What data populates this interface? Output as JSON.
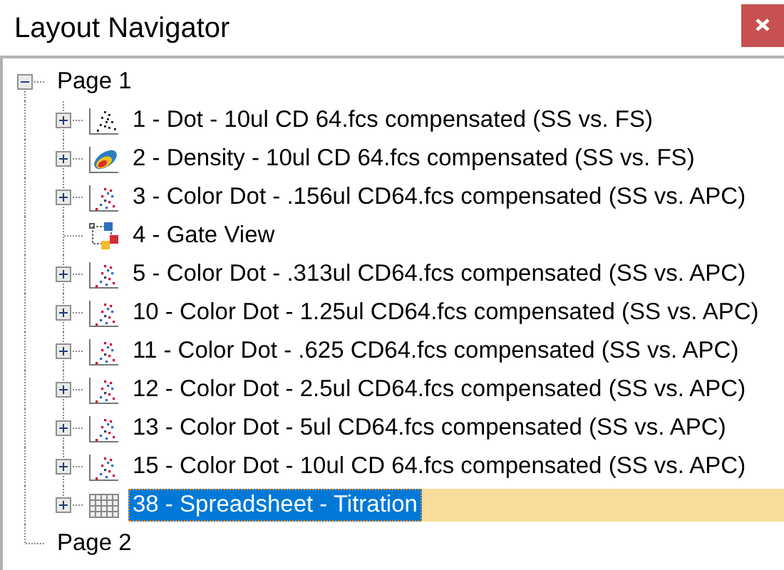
{
  "window": {
    "title": "Layout Navigator"
  },
  "tree": [
    {
      "label": "Page 1",
      "expandable": true,
      "expanded": true,
      "selected": false,
      "children": [
        {
          "label": "1 - Dot - 10ul CD 64.fcs compensated (SS vs. FS)",
          "kind": "dot",
          "expandable": true,
          "expanded": false,
          "selected": false
        },
        {
          "label": "2 - Density - 10ul CD 64.fcs compensated (SS vs. FS)",
          "kind": "density",
          "expandable": true,
          "expanded": false,
          "selected": false
        },
        {
          "label": "3 - Color Dot - .156ul CD64.fcs compensated (SS vs. APC)",
          "kind": "color-dot",
          "expandable": true,
          "expanded": false,
          "selected": false
        },
        {
          "label": "4 - Gate View",
          "kind": "gate",
          "expandable": false,
          "selected": false
        },
        {
          "label": "5 - Color Dot - .313ul CD64.fcs compensated (SS vs. APC)",
          "kind": "color-dot",
          "expandable": true,
          "expanded": false,
          "selected": false
        },
        {
          "label": "10 - Color Dot - 1.25ul CD64.fcs compensated (SS vs. APC)",
          "kind": "color-dot",
          "expandable": true,
          "expanded": false,
          "selected": false
        },
        {
          "label": "11 - Color Dot - .625 CD64.fcs compensated (SS vs. APC)",
          "kind": "color-dot",
          "expandable": true,
          "expanded": false,
          "selected": false
        },
        {
          "label": "12 - Color Dot - 2.5ul CD64.fcs compensated (SS vs. APC)",
          "kind": "color-dot",
          "expandable": true,
          "expanded": false,
          "selected": false
        },
        {
          "label": "13 - Color Dot - 5ul CD64.fcs compensated (SS vs. APC)",
          "kind": "color-dot",
          "expandable": true,
          "expanded": false,
          "selected": false
        },
        {
          "label": "15 - Color Dot - 10ul CD 64.fcs compensated (SS vs. APC)",
          "kind": "color-dot",
          "expandable": true,
          "expanded": false,
          "selected": false
        },
        {
          "label": "38 - Spreadsheet - Titration",
          "kind": "spreadsheet",
          "expandable": true,
          "expanded": false,
          "selected": true
        }
      ]
    },
    {
      "label": "Page 2",
      "expandable": false,
      "selected": false
    }
  ]
}
